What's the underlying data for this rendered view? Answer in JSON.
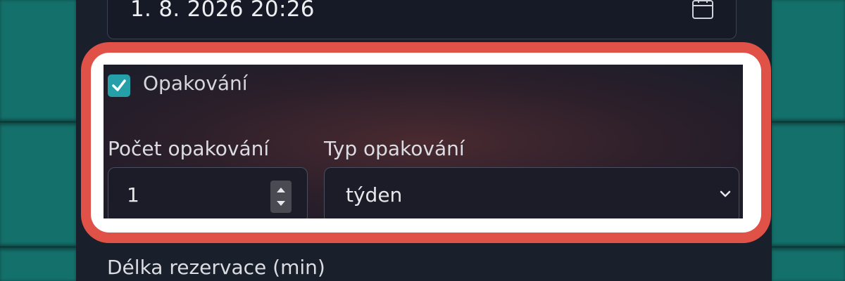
{
  "datetime": {
    "value": "1. 8. 2026 20:26"
  },
  "repeat": {
    "checkbox_label": "Opakování",
    "checked": true,
    "count_label": "Počet opakování",
    "count_value": "1",
    "type_label": "Typ opakování",
    "type_value": "týden"
  },
  "duration": {
    "label": "Délka rezervace (min)"
  },
  "colors": {
    "highlight": "#e05247",
    "accent": "#26a0a8",
    "modal_bg": "#1a1f2c"
  }
}
